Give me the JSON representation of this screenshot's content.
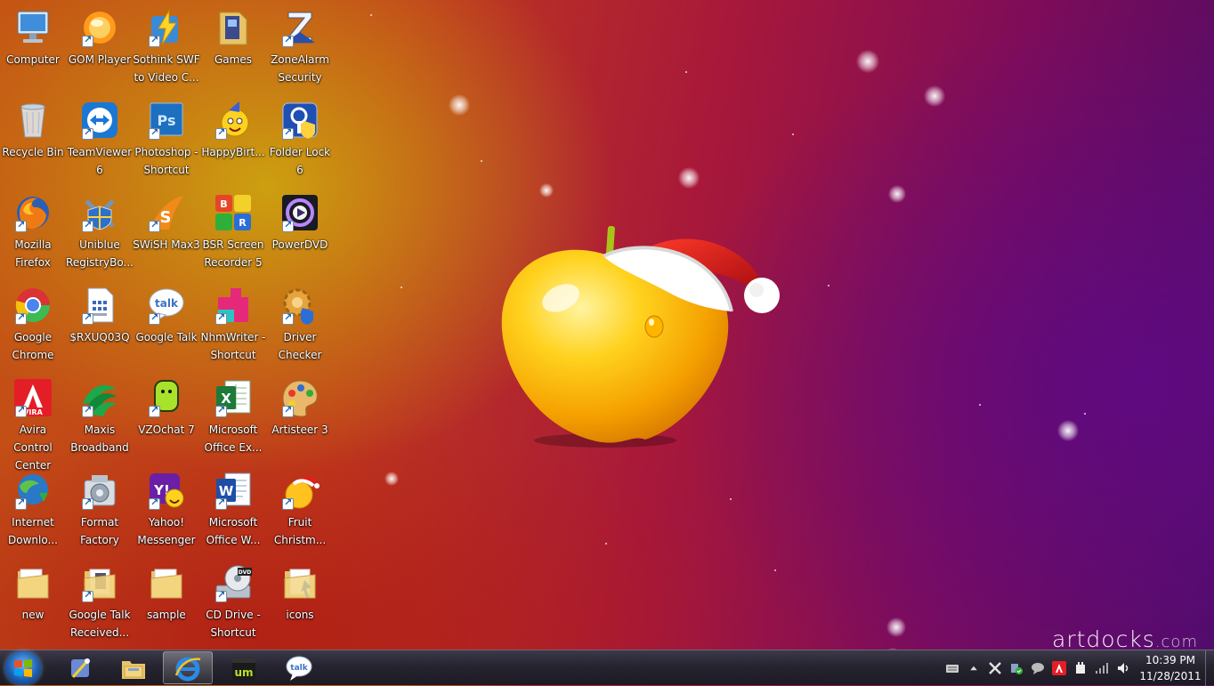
{
  "desktop": {
    "icons": [
      {
        "label": "Computer",
        "icon": "computer-icon"
      },
      {
        "label": "GOM Player",
        "icon": "gom-player-icon"
      },
      {
        "label": "Sothink SWF to Video C...",
        "icon": "sothink-icon"
      },
      {
        "label": "Games",
        "icon": "games-folder-icon"
      },
      {
        "label": "ZoneAlarm Security",
        "icon": "zonealarm-icon"
      },
      {
        "label": "Recycle Bin",
        "icon": "recycle-bin-icon"
      },
      {
        "label": "TeamViewer 6",
        "icon": "teamviewer-icon"
      },
      {
        "label": "Photoshop - Shortcut",
        "icon": "photoshop-icon"
      },
      {
        "label": "HappyBirt...",
        "icon": "happybirthday-icon"
      },
      {
        "label": "Folder Lock 6",
        "icon": "folder-lock-icon"
      },
      {
        "label": "Mozilla Firefox",
        "icon": "firefox-icon"
      },
      {
        "label": "Uniblue RegistryBo...",
        "icon": "uniblue-icon"
      },
      {
        "label": "SWiSH Max3",
        "icon": "swish-icon"
      },
      {
        "label": "BSR Screen Recorder 5",
        "icon": "bsr-icon"
      },
      {
        "label": "PowerDVD",
        "icon": "powerdvd-icon"
      },
      {
        "label": "Google Chrome",
        "icon": "chrome-icon"
      },
      {
        "label": "$RXUQ03Q",
        "icon": "file-icon"
      },
      {
        "label": "Google Talk",
        "icon": "google-talk-icon"
      },
      {
        "label": "NhmWriter - Shortcut",
        "icon": "nhmwriter-icon"
      },
      {
        "label": "Driver Checker",
        "icon": "driver-checker-icon"
      },
      {
        "label": "Avira Control Center",
        "icon": "avira-icon"
      },
      {
        "label": "Maxis Broadband",
        "icon": "maxis-icon"
      },
      {
        "label": "VZOchat 7",
        "icon": "vzochat-icon"
      },
      {
        "label": "Microsoft Office Ex...",
        "icon": "excel-icon"
      },
      {
        "label": "Artisteer 3",
        "icon": "artisteer-icon"
      },
      {
        "label": "Internet Downlo...",
        "icon": "idm-icon"
      },
      {
        "label": "Format Factory",
        "icon": "format-factory-icon"
      },
      {
        "label": "Yahoo! Messenger",
        "icon": "yahoo-messenger-icon"
      },
      {
        "label": "Microsoft Office W...",
        "icon": "word-icon"
      },
      {
        "label": "Fruit Christm...",
        "icon": "fruit-christmas-icon"
      },
      {
        "label": "new",
        "icon": "folder-icon"
      },
      {
        "label": "Google Talk Received...",
        "icon": "folder-icon"
      },
      {
        "label": "sample",
        "icon": "folder-icon"
      },
      {
        "label": "CD Drive - Shortcut",
        "icon": "dvd-drive-icon"
      },
      {
        "label": "icons",
        "icon": "folder-icon"
      }
    ],
    "watermark": {
      "brand": "artdocks",
      "suffix": ".com"
    }
  },
  "taskbar": {
    "pinned": [
      {
        "name": "jumplist-app",
        "icon": "wand-icon"
      },
      {
        "name": "explorer",
        "icon": "explorer-folder-icon"
      },
      {
        "name": "internet-explorer",
        "icon": "ie-icon",
        "active": true
      },
      {
        "name": "media",
        "icon": "um-media-icon"
      },
      {
        "name": "google-talk",
        "icon": "google-talk-icon"
      }
    ],
    "tray_icons": [
      "keyboard-icon",
      "show-hidden-icon",
      "x-app-icon",
      "network-check-icon",
      "chat-bubble-icon",
      "avira-tray-icon",
      "power-icon",
      "signal-icon",
      "volume-icon"
    ],
    "clock": {
      "time": "10:39 PM",
      "date": "11/28/2011"
    }
  },
  "colors": {
    "accent": "#1d5fb0",
    "wallpaper_left": "#c45414",
    "wallpaper_right": "#4c0c66"
  }
}
